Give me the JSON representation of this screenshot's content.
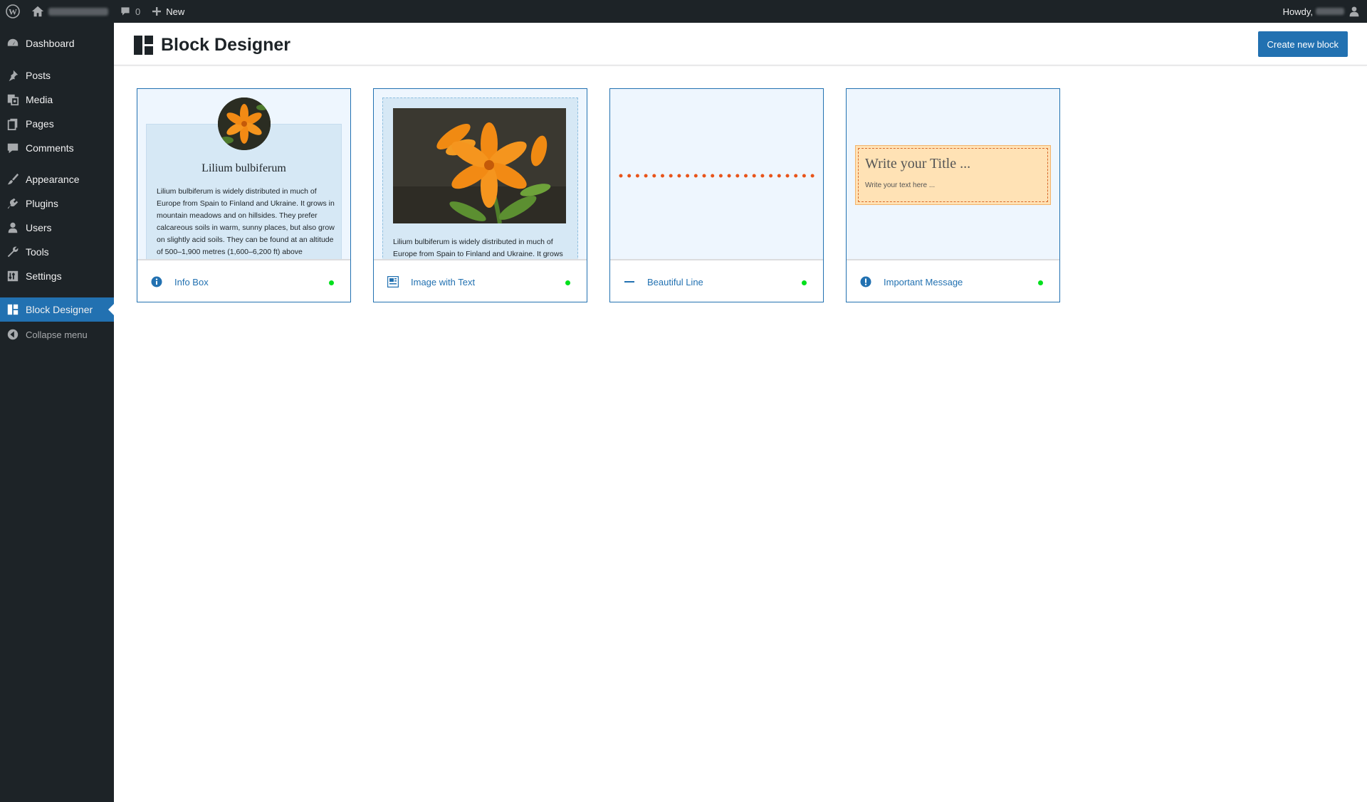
{
  "admin_bar": {
    "wp_logo_icon": "wordpress-logo-icon",
    "home_icon": "home-icon",
    "comments_icon": "comment-bubble-icon",
    "comments_count": "0",
    "new_label": "New",
    "new_icon": "plus-icon",
    "howdy_label": "Howdy,",
    "user_icon": "user-avatar-icon"
  },
  "sidebar": {
    "items": [
      {
        "label": "Dashboard",
        "icon": "dashboard-icon"
      },
      {
        "label": "Posts",
        "icon": "pushpin-icon"
      },
      {
        "label": "Media",
        "icon": "media-icon"
      },
      {
        "label": "Pages",
        "icon": "pages-icon"
      },
      {
        "label": "Comments",
        "icon": "comment-bubble-icon"
      },
      {
        "label": "Appearance",
        "icon": "paintbrush-icon"
      },
      {
        "label": "Plugins",
        "icon": "plugin-icon"
      },
      {
        "label": "Users",
        "icon": "users-icon"
      },
      {
        "label": "Tools",
        "icon": "wrench-icon"
      },
      {
        "label": "Settings",
        "icon": "settings-icon"
      },
      {
        "label": "Block Designer",
        "icon": "block-layout-icon",
        "current": true
      }
    ],
    "collapse_label": "Collapse menu"
  },
  "header": {
    "title": "Block Designer",
    "create_button": "Create new block"
  },
  "blocks": [
    {
      "name": "Info Box",
      "icon": "info-icon",
      "status": "active",
      "preview": {
        "title": "Lilium bulbiferum",
        "text": "Lilium bulbiferum is widely distributed in much of Europe from Spain to Finland and Ukraine. It grows in mountain meadows and on hillsides. They prefer calcareous soils in warm, sunny places, but also grow on slightly acid soils. They can be found at an altitude of 500–1,900 metres (1,600–6,200 ft) above"
      }
    },
    {
      "name": "Image with Text",
      "icon": "image-text-icon",
      "status": "active",
      "preview": {
        "text": "Lilium bulbiferum is widely distributed in much of Europe from Spain to Finland and Ukraine. It grows"
      }
    },
    {
      "name": "Beautiful Line",
      "icon": "minus-line-icon",
      "status": "active"
    },
    {
      "name": "Important Message",
      "icon": "exclamation-icon",
      "status": "active",
      "preview": {
        "title": "Write your Title ...",
        "text": "Write your text here ..."
      }
    }
  ],
  "colors": {
    "accent": "#2271b1",
    "sidebar_bg": "#1d2327",
    "status_active": "#00e01c",
    "line_dots": "#e8541a",
    "message_bg": "#ffe2b5"
  }
}
